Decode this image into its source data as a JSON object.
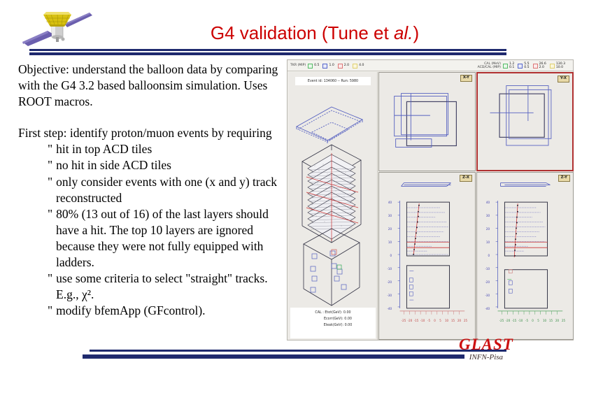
{
  "slide": {
    "title_prefix": "G4 validation (Tune et ",
    "title_italic": "al.",
    "title_suffix": ")",
    "logo_alt": "glast-satellite-logo"
  },
  "body": {
    "paragraph1": "Objective: understand the balloon data by comparing with the G4 3.2 based balloonsim simulation.  Uses ROOT macros.",
    "paragraph2": "First step: identify proton/muon events by requiring",
    "bullet_char": "\"",
    "bullets": [
      "hit in top ACD tiles",
      "no hit in side ACD tiles",
      "only consider events with one (x and y) track reconstructed",
      "80% (13 out of 16) of the last layers should have a hit.  The top 10 layers are ignored because they were not fully equipped with ladders.",
      "use some criteria to select \"straight\" tracks.  E.g., χ².",
      "modify bfemApp (GFcontrol)."
    ]
  },
  "event_display": {
    "legend_left": {
      "label": "TKR (MIP)",
      "entries": [
        {
          "color": "#55bb66",
          "value": "0.5"
        },
        {
          "color": "#5566cc",
          "value": "1.0"
        },
        {
          "color": "#dd7777",
          "value": "2.0"
        },
        {
          "color": "#e0d070",
          "value": "4.0"
        }
      ]
    },
    "legend_right": {
      "label_line1": "CAL (MeV)",
      "label_line2": "ACD/CAL (MIP)",
      "entries": [
        {
          "color": "#55bb66",
          "top": "1.2",
          "bottom": "0.1"
        },
        {
          "color": "#5566cc",
          "top": "5.5",
          "bottom": "0.5"
        },
        {
          "color": "#dd7777",
          "top": "26.6",
          "bottom": "2.0"
        },
        {
          "color": "#e0d070",
          "top": "130.3",
          "bottom": "10.0"
        }
      ]
    },
    "event_id": "Event id: 134060  --  Run: 5980",
    "cal_energy": [
      "CAL : Etot(GeV): 0.00",
      "Ecorr(GeV): 0.00",
      "Eleak(GeV): 0.00"
    ],
    "views": [
      {
        "tag": "X-Y"
      },
      {
        "tag": "Y-X"
      },
      {
        "tag": "Z-X"
      },
      {
        "tag": "Z-Y"
      }
    ],
    "z_axis_ticks": [
      "40",
      "30",
      "20",
      "10",
      "0",
      "-10",
      "-20",
      "-30",
      "-40"
    ],
    "x_axis_ticks": [
      "-25",
      "-20",
      "-15",
      "-10",
      "-5",
      "0",
      "5",
      "10",
      "15",
      "20",
      "25"
    ]
  },
  "footer": {
    "logo_main": "GLAST",
    "logo_sub": "INFN-Pisa"
  },
  "colors": {
    "title": "#cc0000",
    "rule": "#1f2a6e",
    "glast": "#cc1111",
    "selected_pane_border": "#b03030"
  }
}
